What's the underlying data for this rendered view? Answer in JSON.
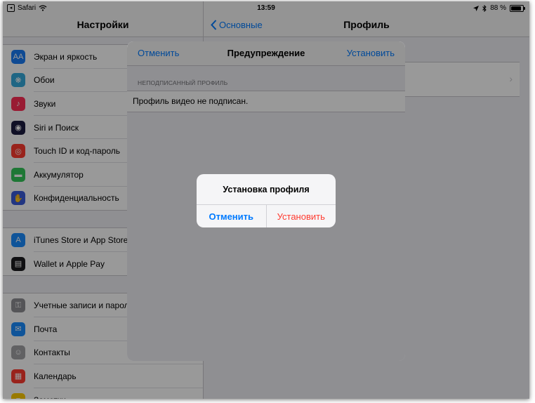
{
  "status_bar": {
    "back_app": "Safari",
    "time": "13:59",
    "battery_percent": "88 %",
    "battery_level": 0.88
  },
  "master": {
    "title": "Настройки",
    "groups": [
      [
        {
          "label": "Экран и яркость",
          "icon": "display-brightness-icon",
          "color": "#1a7cf5",
          "glyph": "AA"
        },
        {
          "label": "Обои",
          "icon": "wallpaper-icon",
          "color": "#35aadc",
          "glyph": "❋"
        },
        {
          "label": "Звуки",
          "icon": "speaker-icon",
          "color": "#ff2d55",
          "glyph": "♪"
        },
        {
          "label": "Siri и Поиск",
          "icon": "siri-icon",
          "color": "#1c1c40",
          "glyph": "◉"
        },
        {
          "label": "Touch ID и код-пароль",
          "icon": "fingerprint-icon",
          "color": "#ff3b30",
          "glyph": "◎"
        },
        {
          "label": "Аккумулятор",
          "icon": "battery-icon",
          "color": "#34c759",
          "glyph": "▬"
        },
        {
          "label": "Конфиденциальность",
          "icon": "privacy-hand-icon",
          "color": "#3a5bd9",
          "glyph": "✋"
        }
      ],
      [
        {
          "label": "iTunes Store и App Store",
          "icon": "app-store-icon",
          "color": "#1a8cff",
          "glyph": "A"
        },
        {
          "label": "Wallet и Apple Pay",
          "icon": "wallet-icon",
          "color": "#1c1c1e",
          "glyph": "▤"
        }
      ],
      [
        {
          "label": "Учетные записи и пароли",
          "icon": "key-icon",
          "color": "#8e8e93",
          "glyph": "⚿"
        },
        {
          "label": "Почта",
          "icon": "mail-icon",
          "color": "#1a8cff",
          "glyph": "✉"
        },
        {
          "label": "Контакты",
          "icon": "contacts-icon",
          "color": "#a2a2a6",
          "glyph": "☺"
        },
        {
          "label": "Календарь",
          "icon": "calendar-icon",
          "color": "#ff3b30",
          "glyph": "▦"
        },
        {
          "label": "Заметки",
          "icon": "notes-icon",
          "color": "#ffcc00",
          "glyph": "≡"
        }
      ]
    ]
  },
  "detail": {
    "back_label": "Основные",
    "title": "Профиль"
  },
  "sheet": {
    "cancel_label": "Отменить",
    "title": "Предупреждение",
    "install_label": "Установить",
    "section_header": "НЕПОДПИСАННЫЙ ПРОФИЛЬ",
    "cell_text": "Профиль видео не подписан."
  },
  "alert": {
    "title": "Установка профиля",
    "cancel_label": "Отменить",
    "install_label": "Установить"
  },
  "colors": {
    "accent": "#007aff",
    "destructive": "#ff3b30"
  }
}
